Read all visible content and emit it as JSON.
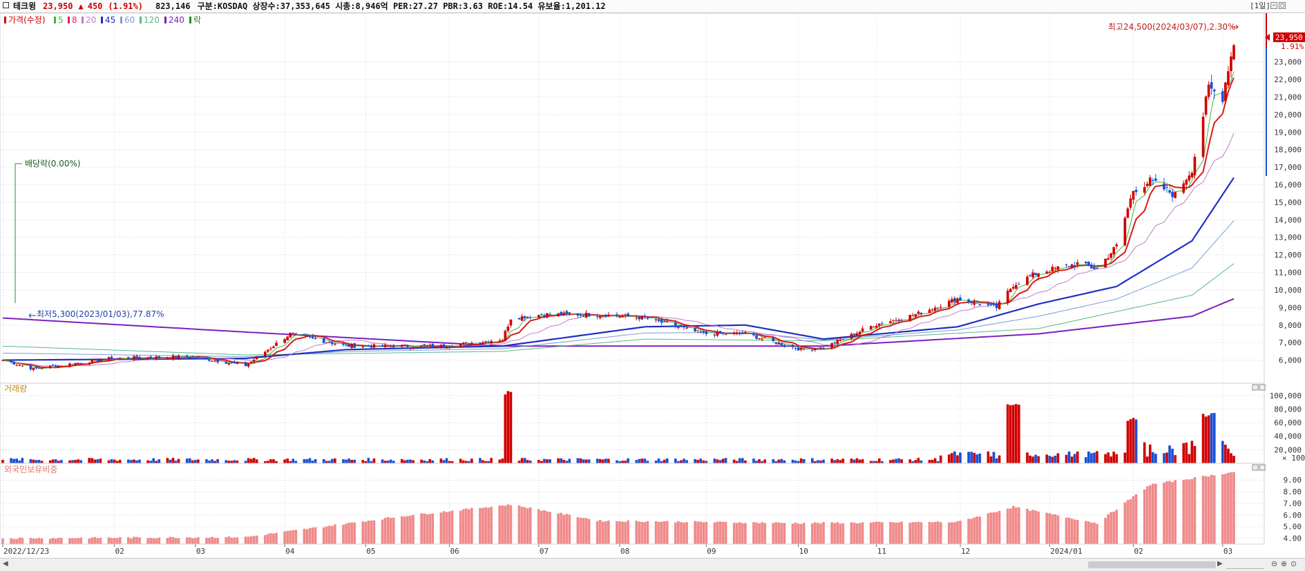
{
  "header": {
    "name": "테크윙",
    "price": "23,950",
    "change_arrow": "▲",
    "change": "450",
    "change_pct": "(1.91%)",
    "volume": "823,146",
    "info": "구분:KOSDAQ 상장수:37,353,645 시총:8,946억 PER:27.27 PBR:3.63 ROE:14.54 유보율:1,201.12",
    "period": "[1일]"
  },
  "legend": [
    {
      "label": "가격(수정)",
      "color": "#d10000"
    },
    {
      "label": "5",
      "color": "#3fb63f"
    },
    {
      "label": "8",
      "color": "#e0205a"
    },
    {
      "label": "20",
      "color": "#c07ac8"
    },
    {
      "label": "45",
      "color": "#1f2fbf"
    },
    {
      "label": "60",
      "color": "#7a9ad8"
    },
    {
      "label": "120",
      "color": "#57b887"
    },
    {
      "label": "240",
      "color": "#7a1fc0"
    },
    {
      "label": "락",
      "color": "#2a8a2a"
    }
  ],
  "annotations": {
    "high": "최고24,500(2024/03/07),2.30%",
    "low": "최저5,300(2023/01/03),77.87%",
    "dividend": "배당락(0.00%)",
    "last_price_tag": "23,950",
    "last_pct": "1.91%"
  },
  "panels": {
    "volume_title": "거래량",
    "foreign_title": "외국인보유비중",
    "volume_unit": "× 100"
  },
  "colors": {
    "up": "#d10000",
    "down": "#1a4fd6",
    "ma5": "#3fb63f",
    "ma8": "#d81a1a",
    "ma20": "#c07ac8",
    "ma45": "#1f2fbf",
    "ma60": "#7a9ad8",
    "ma120": "#57b887",
    "ma240": "#7a1fc0",
    "foreign_bar": "#f08a8a",
    "grid": "#e4e4ee"
  },
  "chart_data": {
    "type": "candlestick+volume+bar",
    "x_ticks": [
      "2022/12/23",
      "02",
      "03",
      "04",
      "05",
      "06",
      "07",
      "08",
      "09",
      "10",
      "11",
      "12",
      "2024/01",
      "02",
      "03"
    ],
    "price_axis": {
      "ticks": [
        "23,000",
        "22,000",
        "21,000",
        "20,000",
        "19,000",
        "18,000",
        "17,000",
        "16,000",
        "15,000",
        "14,000",
        "13,000",
        "12,000",
        "11,000",
        "10,000",
        "9,000",
        "8,000",
        "7,000",
        "6,000"
      ],
      "range": [
        5000,
        24600
      ],
      "unit": "KRW"
    },
    "volume_axis": {
      "ticks": [
        "100,000",
        "80,000",
        "60,000",
        "40,000",
        "20,000"
      ],
      "range": [
        0,
        110000
      ],
      "unit": "× 100 shares"
    },
    "foreign_axis": {
      "ticks": [
        "9.00",
        "8.00",
        "7.00",
        "6.00",
        "5.00",
        "4.00"
      ],
      "range": [
        3.5,
        10.2
      ],
      "unit": "%"
    },
    "price_keypoints": [
      {
        "date": "2022/12/23",
        "close": 6000
      },
      {
        "date": "2023/01/03",
        "close": 5500
      },
      {
        "date": "2023/01/31",
        "close": 6100
      },
      {
        "date": "2023/02/28",
        "close": 6200
      },
      {
        "date": "2023/03/20",
        "close": 5700
      },
      {
        "date": "2023/04/05",
        "close": 7500
      },
      {
        "date": "2023/04/25",
        "close": 6800
      },
      {
        "date": "2023/05/31",
        "close": 6800
      },
      {
        "date": "2023/06/20",
        "close": 7200
      },
      {
        "date": "2023/06/23",
        "close": 8400
      },
      {
        "date": "2023/07/05",
        "close": 8600
      },
      {
        "date": "2023/07/25",
        "close": 8600
      },
      {
        "date": "2023/08/10",
        "close": 8400
      },
      {
        "date": "2023/08/31",
        "close": 7500
      },
      {
        "date": "2023/09/15",
        "close": 7500
      },
      {
        "date": "2023/10/05",
        "close": 6600
      },
      {
        "date": "2023/10/13",
        "close": 6700
      },
      {
        "date": "2023/10/31",
        "close": 8000
      },
      {
        "date": "2023/11/15",
        "close": 8600
      },
      {
        "date": "2023/11/30",
        "close": 9500
      },
      {
        "date": "2023/12/14",
        "close": 9000
      },
      {
        "date": "2023/12/20",
        "close": 10300
      },
      {
        "date": "2023/12/29",
        "close": 11000
      },
      {
        "date": "2024/01/12",
        "close": 11500
      },
      {
        "date": "2024/01/19",
        "close": 11200
      },
      {
        "date": "2024/01/26",
        "close": 12500
      },
      {
        "date": "2024/02/01",
        "close": 15700
      },
      {
        "date": "2024/02/07",
        "close": 16200
      },
      {
        "date": "2024/02/16",
        "close": 15400
      },
      {
        "date": "2024/02/22",
        "close": 16900
      },
      {
        "date": "2024/02/28",
        "close": 21500
      },
      {
        "date": "2024/03/04",
        "close": 21000
      },
      {
        "date": "2024/03/06",
        "close": 22700
      },
      {
        "date": "2024/03/08",
        "close": 23950
      }
    ],
    "ma_keypoints": {
      "ma45": [
        {
          "date": "2022/12/23",
          "v": 6000
        },
        {
          "date": "2023/03/20",
          "v": 6100
        },
        {
          "date": "2023/04/25",
          "v": 6600
        },
        {
          "date": "2023/06/20",
          "v": 6800
        },
        {
          "date": "2023/08/10",
          "v": 7900
        },
        {
          "date": "2023/09/15",
          "v": 8000
        },
        {
          "date": "2023/10/13",
          "v": 7200
        },
        {
          "date": "2023/11/30",
          "v": 7900
        },
        {
          "date": "2023/12/29",
          "v": 9200
        },
        {
          "date": "2024/01/26",
          "v": 10200
        },
        {
          "date": "2024/02/22",
          "v": 12800
        },
        {
          "date": "2024/03/08",
          "v": 16400
        }
      ],
      "ma240": [
        {
          "date": "2022/12/23",
          "v": 8400
        },
        {
          "date": "2023/03/20",
          "v": 7600
        },
        {
          "date": "2023/06/20",
          "v": 6800
        },
        {
          "date": "2023/10/13",
          "v": 6800
        },
        {
          "date": "2023/12/29",
          "v": 7500
        },
        {
          "date": "2024/02/22",
          "v": 8500
        },
        {
          "date": "2024/03/08",
          "v": 9500
        }
      ],
      "ma120": [
        {
          "date": "2022/12/23",
          "v": 6800
        },
        {
          "date": "2023/03/20",
          "v": 6300
        },
        {
          "date": "2023/06/20",
          "v": 6500
        },
        {
          "date": "2023/08/10",
          "v": 7200
        },
        {
          "date": "2023/10/13",
          "v": 7100
        },
        {
          "date": "2023/12/29",
          "v": 7800
        },
        {
          "date": "2024/02/22",
          "v": 9700
        },
        {
          "date": "2024/03/08",
          "v": 11500
        }
      ]
    },
    "volume_spikes": [
      {
        "date": "2023/06/23",
        "value": 107000
      },
      {
        "date": "2023/12/20",
        "value": 88000
      },
      {
        "date": "2024/02/01",
        "value": 67000
      },
      {
        "date": "2024/02/28",
        "value": 75000
      }
    ],
    "foreign_keypoints": [
      {
        "date": "2022/12/23",
        "v": 4.0
      },
      {
        "date": "2023/03/20",
        "v": 4.1
      },
      {
        "date": "2023/05/15",
        "v": 5.9
      },
      {
        "date": "2023/06/23",
        "v": 6.9
      },
      {
        "date": "2023/07/25",
        "v": 5.5
      },
      {
        "date": "2023/10/05",
        "v": 5.3
      },
      {
        "date": "2023/11/30",
        "v": 5.4
      },
      {
        "date": "2023/12/20",
        "v": 6.7
      },
      {
        "date": "2024/01/19",
        "v": 5.3
      },
      {
        "date": "2024/02/07",
        "v": 8.6
      },
      {
        "date": "2024/03/08",
        "v": 9.7
      }
    ]
  }
}
